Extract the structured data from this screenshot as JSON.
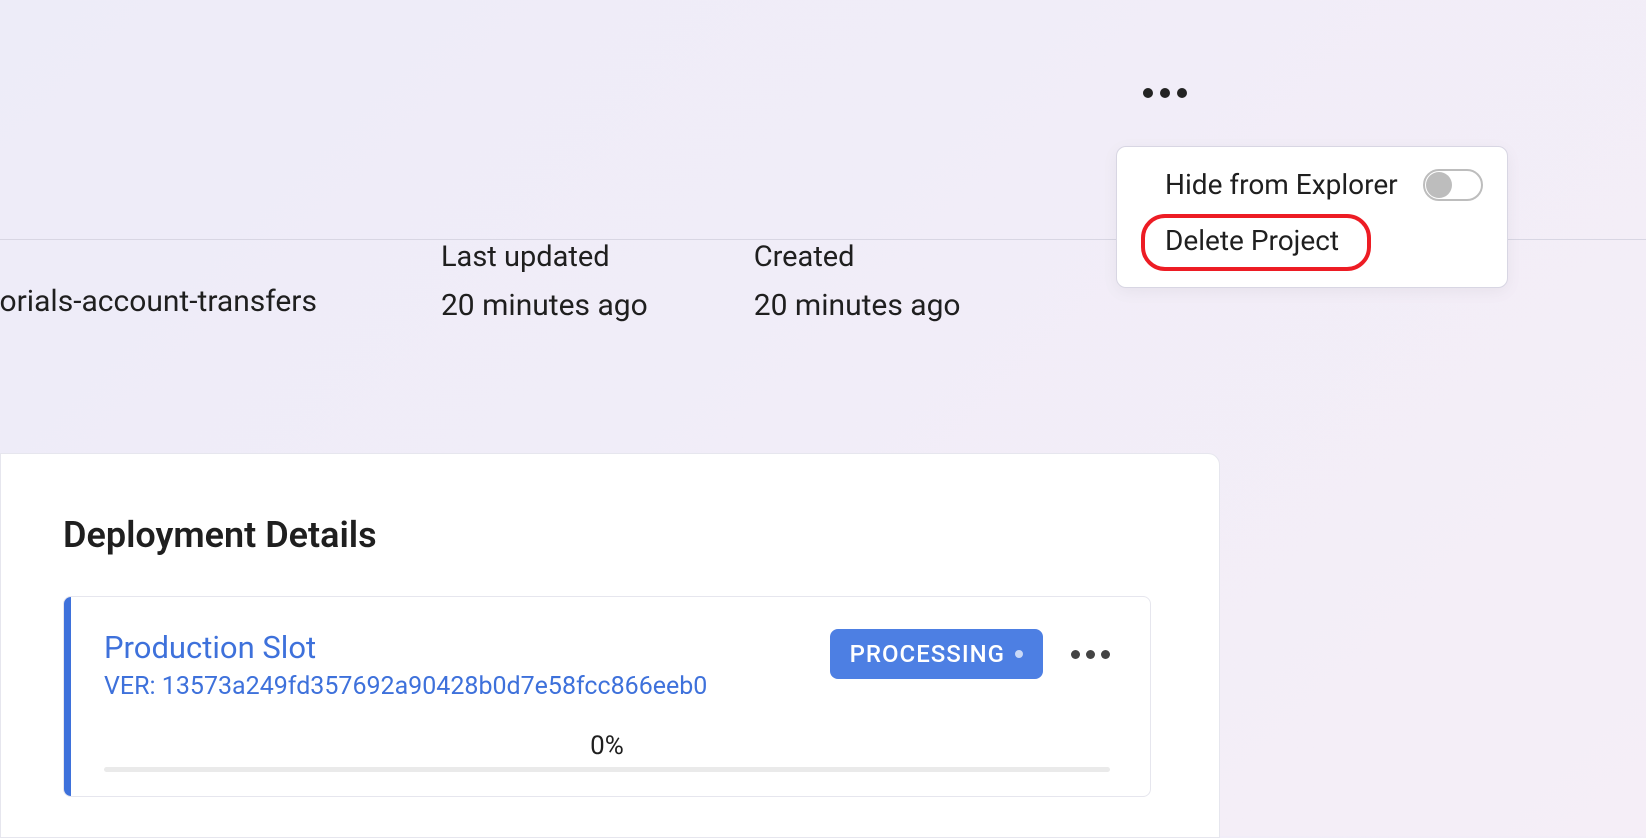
{
  "menu": {
    "hide_label": "Hide from Explorer",
    "delete_label": "Delete Project"
  },
  "project": {
    "name_fragment": "torials-account-transfers"
  },
  "meta": {
    "last_updated_label": "Last updated",
    "last_updated_value": "20 minutes ago",
    "created_label": "Created",
    "created_value": "20 minutes ago"
  },
  "details": {
    "title": "Deployment Details",
    "slot": {
      "title": "Production Slot",
      "version_label": "VER: 13573a249fd357692a90428b0d7e58fcc866eeb0",
      "status": "PROCESSING",
      "progress": "0%"
    }
  }
}
